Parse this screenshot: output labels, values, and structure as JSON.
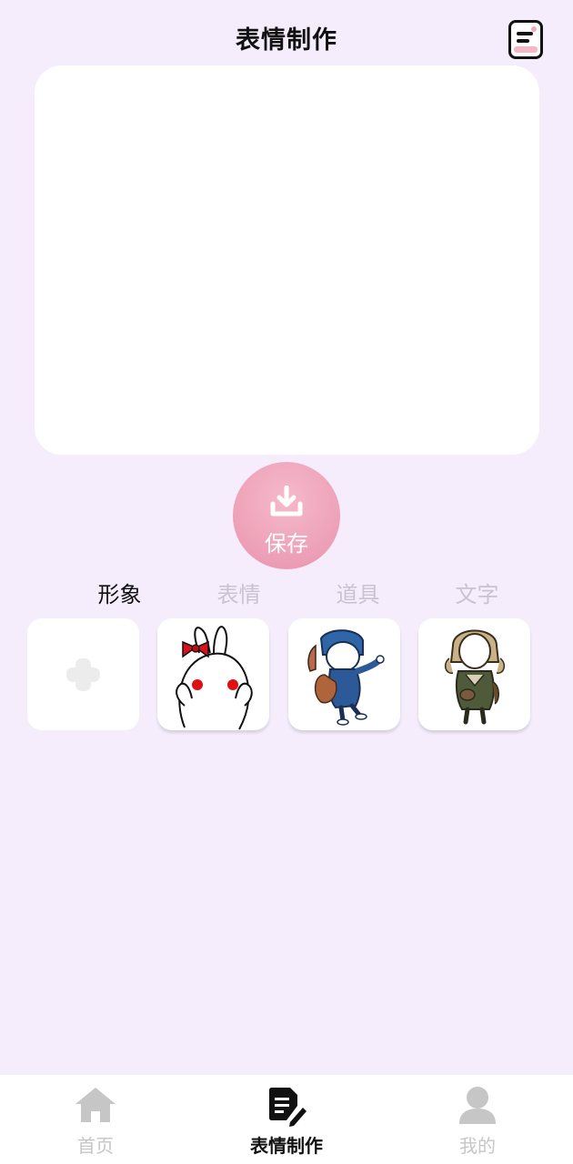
{
  "header": {
    "title": "表情制作",
    "menu_icon": "menu-list-icon"
  },
  "save_button": {
    "label": "保存",
    "icon": "download-icon"
  },
  "tabs": [
    {
      "label": "形象",
      "active": true
    },
    {
      "label": "表情",
      "active": false
    },
    {
      "label": "道具",
      "active": false
    },
    {
      "label": "文字",
      "active": false
    }
  ],
  "characters": [
    {
      "type": "add",
      "icon": "plus-icon"
    },
    {
      "type": "character",
      "icon": "rabbit-bow-character"
    },
    {
      "type": "character",
      "icon": "blue-hooded-kid-character"
    },
    {
      "type": "character",
      "icon": "detective-hat-character"
    }
  ],
  "bottom_nav": [
    {
      "label": "首页",
      "icon": "home-icon",
      "active": false
    },
    {
      "label": "表情制作",
      "icon": "edit-document-icon",
      "active": true
    },
    {
      "label": "我的",
      "icon": "user-icon",
      "active": false
    }
  ],
  "colors": {
    "background": "#f5edfc",
    "accent_pink": "#eea3b9",
    "inactive_text": "#c9c2cf"
  }
}
